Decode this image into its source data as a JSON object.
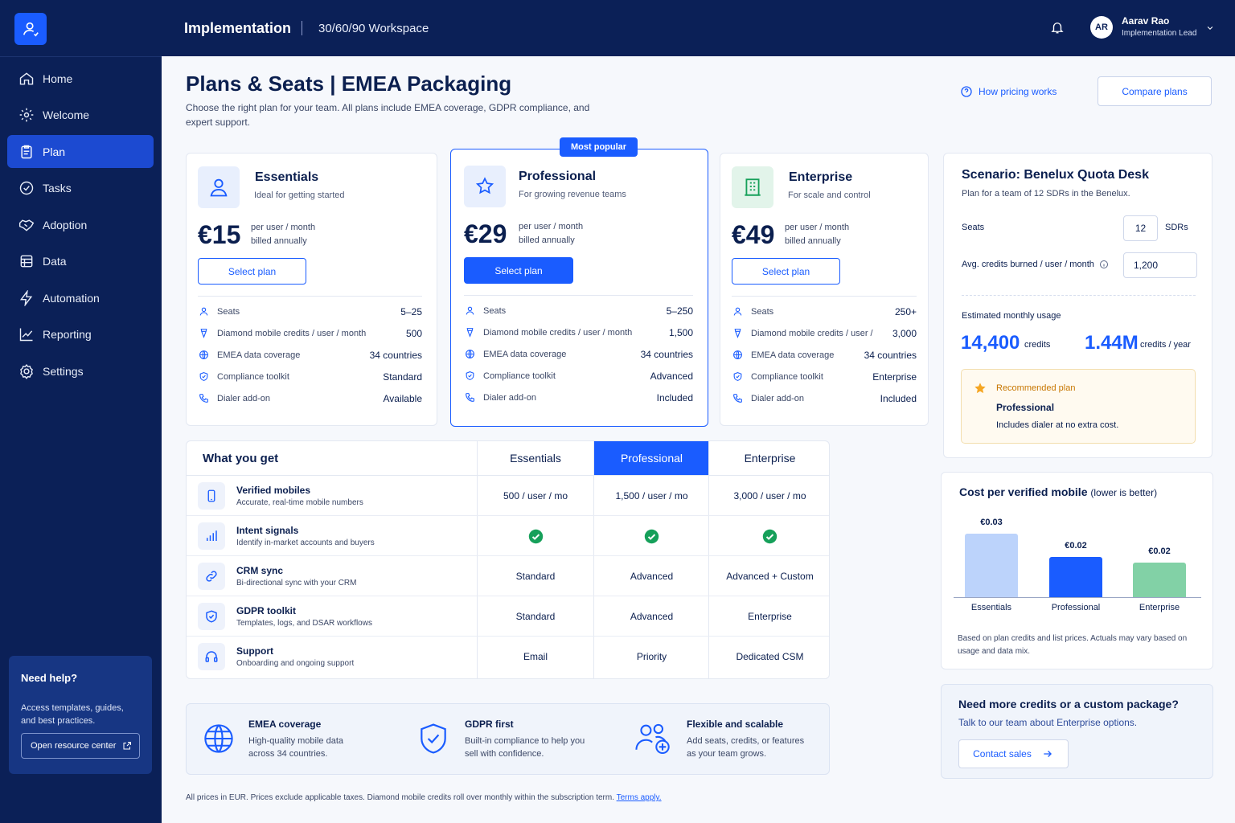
{
  "topbar": {
    "title": "Implementation",
    "workspace": "30/60/90 Workspace",
    "user_initials": "AR",
    "user_name": "Aarav Rao",
    "user_role": "Implementation Lead"
  },
  "sidebar": {
    "items": [
      {
        "label": "Home",
        "icon": "home-icon"
      },
      {
        "label": "Welcome",
        "icon": "gear-badge-icon"
      },
      {
        "label": "Plan",
        "icon": "clipboard-icon",
        "active": true
      },
      {
        "label": "Tasks",
        "icon": "check-circle-icon"
      },
      {
        "label": "Adoption",
        "icon": "handshake-icon"
      },
      {
        "label": "Data",
        "icon": "database-icon"
      },
      {
        "label": "Automation",
        "icon": "lightning-icon"
      },
      {
        "label": "Reporting",
        "icon": "chart-line-icon"
      },
      {
        "label": "Settings",
        "icon": "settings-icon"
      }
    ],
    "help": {
      "title": "Need help?",
      "text": "Access templates, guides, and best practices.",
      "button": "Open resource center"
    }
  },
  "header": {
    "title": "Plans & Seats | EMEA Packaging",
    "subtitle": "Choose the right plan for your team. All plans include EMEA coverage, GDPR compliance, and expert support.",
    "how_link": "How pricing works",
    "compare_button": "Compare plans"
  },
  "plans": [
    {
      "name": "Essentials",
      "desc": "Ideal for getting started",
      "price": "€15",
      "unit": "per user / month",
      "billing": "billed annually",
      "button": "Select plan",
      "features": [
        {
          "label": "Seats",
          "value": "5–25"
        },
        {
          "label": "Diamond mobile credits / user / month",
          "value": "500"
        },
        {
          "label": "EMEA data coverage",
          "value": "34 countries"
        },
        {
          "label": "Compliance toolkit",
          "value": "Standard"
        },
        {
          "label": "Dialer add-on",
          "value": "Available"
        }
      ]
    },
    {
      "name": "Professional",
      "badge": "Most popular",
      "desc": "For growing revenue teams",
      "price": "€29",
      "unit": "per user / month",
      "billing": "billed annually",
      "button": "Select plan",
      "features": [
        {
          "label": "Seats",
          "value": "5–250"
        },
        {
          "label": "Diamond mobile credits / user / month",
          "value": "1,500"
        },
        {
          "label": "EMEA data coverage",
          "value": "34 countries"
        },
        {
          "label": "Compliance toolkit",
          "value": "Advanced"
        },
        {
          "label": "Dialer add-on",
          "value": "Included"
        }
      ]
    },
    {
      "name": "Enterprise",
      "desc": "For scale and control",
      "price": "€49",
      "unit": "per user / month",
      "billing": "billed annually",
      "button": "Select plan",
      "features": [
        {
          "label": "Seats",
          "value": "250+"
        },
        {
          "label": "Diamond mobile credits / user /",
          "value": "3,000"
        },
        {
          "label": "EMEA data coverage",
          "value": "34 countries"
        },
        {
          "label": "Compliance toolkit",
          "value": "Enterprise"
        },
        {
          "label": "Dialer add-on",
          "value": "Included"
        }
      ]
    }
  ],
  "scenario": {
    "title": "Scenario: Benelux Quota Desk",
    "subtitle": "Plan for a team of 12 SDRs in the Benelux.",
    "seats_label": "Seats",
    "seats_value": "12",
    "seats_unit": "SDRs",
    "credits_label": "Avg. credits burned / user / month",
    "credits_value": "1,200",
    "usage_label": "Estimated monthly usage",
    "monthly_value": "14,400",
    "monthly_unit": "credits",
    "yearly_value": "1.44M",
    "yearly_unit": "credits / year",
    "rec_label": "Recommended plan",
    "rec_plan": "Professional",
    "rec_note": "Includes dialer at no extra cost."
  },
  "comparison": {
    "heading": "What you get",
    "columns": [
      "Essentials",
      "Professional",
      "Enterprise"
    ],
    "rows": [
      {
        "name": "Verified mobiles",
        "desc": "Accurate, real-time mobile numbers",
        "icon": "phone-icon",
        "values": [
          "500 / user / mo",
          "1,500 / user / mo",
          "3,000 / user / mo"
        ]
      },
      {
        "name": "Intent signals",
        "desc": "Identify in-market accounts and buyers",
        "icon": "signal-bars-icon",
        "check": true,
        "values": [
          "",
          "",
          ""
        ]
      },
      {
        "name": "CRM sync",
        "desc": "Bi-directional sync with your CRM",
        "icon": "sync-link-icon",
        "values": [
          "Standard",
          "Advanced",
          "Advanced + Custom"
        ]
      },
      {
        "name": "GDPR toolkit",
        "desc": "Templates, logs, and DSAR workflows",
        "icon": "shield-check-icon",
        "values": [
          "Standard",
          "Advanced",
          "Enterprise"
        ]
      },
      {
        "name": "Support",
        "desc": "Onboarding and ongoing support",
        "icon": "headset-icon",
        "values": [
          "Email",
          "Priority",
          "Dedicated CSM"
        ]
      }
    ]
  },
  "benefits": [
    {
      "title": "EMEA coverage",
      "desc": "High-quality mobile data across 34 countries.",
      "icon": "globe-icon"
    },
    {
      "title": "GDPR first",
      "desc": "Built-in compliance to help you sell with confidence.",
      "icon": "shield-check-icon"
    },
    {
      "title": "Flexible and scalable",
      "desc": "Add seats, credits, or features as your team grows.",
      "icon": "users-plus-icon"
    }
  ],
  "cost_chart": {
    "title": "Cost per verified mobile",
    "title_note": "(lower is better)",
    "note": "Based on plan credits and list prices. Actuals may vary based on usage and data mix."
  },
  "chart_data": {
    "type": "bar",
    "title": "Cost per verified mobile (lower is better)",
    "categories": [
      "Essentials",
      "Professional",
      "Enterprise"
    ],
    "values": [
      0.03,
      0.02,
      0.02
    ],
    "labels": [
      "€0.03",
      "€0.02",
      "€0.02"
    ],
    "colors": [
      "#bcd3fb",
      "#1a5cff",
      "#82d1a6"
    ],
    "xlabel": "",
    "ylabel": ""
  },
  "custom": {
    "title": "Need more credits or a custom package?",
    "desc": "Talk to our team about Enterprise options.",
    "button": "Contact sales"
  },
  "footer": {
    "text": "All prices in EUR. Prices exclude applicable taxes. Diamond mobile credits roll over monthly within the subscription term.",
    "link": "Terms apply."
  },
  "colors": {
    "brand": "#1a5cff",
    "navy": "#0b2057",
    "success": "#16a05a",
    "warning": "#f5a623"
  }
}
